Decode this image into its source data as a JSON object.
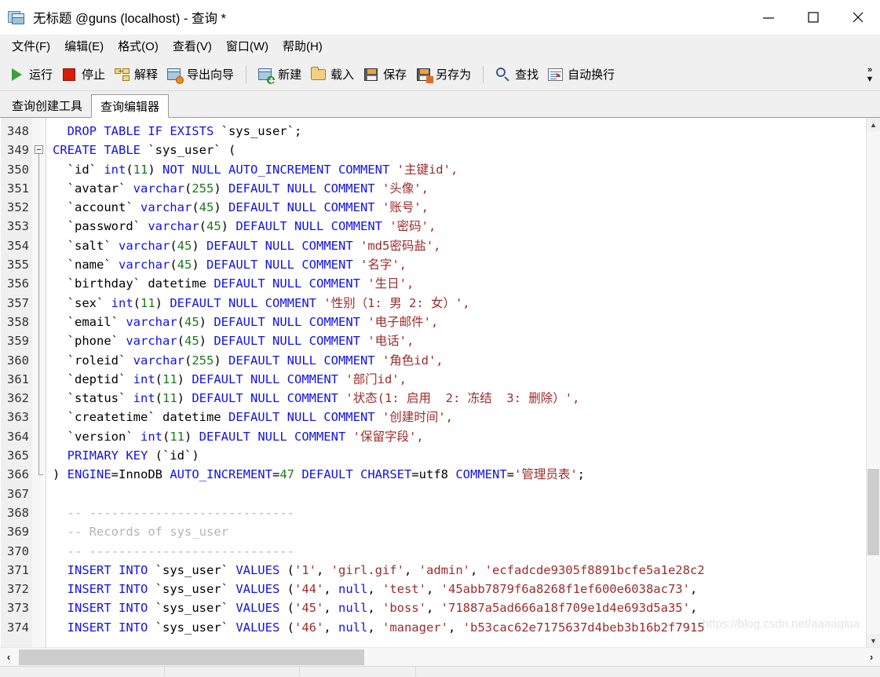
{
  "window": {
    "title": "无标题 @guns (localhost) - 查询 *",
    "icon": "query-table-icon",
    "controls": {
      "minimize": "minimize-icon",
      "maximize": "maximize-icon",
      "close": "close-icon"
    }
  },
  "menubar": {
    "items": [
      {
        "label": "文件(F)",
        "mnemonic": "F"
      },
      {
        "label": "编辑(E)",
        "mnemonic": "E"
      },
      {
        "label": "格式(O)",
        "mnemonic": "O"
      },
      {
        "label": "查看(V)",
        "mnemonic": "V"
      },
      {
        "label": "窗口(W)",
        "mnemonic": "W"
      },
      {
        "label": "帮助(H)",
        "mnemonic": "H"
      }
    ]
  },
  "toolbar": {
    "buttons": [
      {
        "label": "运行",
        "icon": "play-icon"
      },
      {
        "label": "停止",
        "icon": "stop-icon"
      },
      {
        "label": "解释",
        "icon": "explain-icon"
      },
      {
        "label": "导出向导",
        "icon": "export-wizard-icon"
      },
      {
        "label": "新建",
        "icon": "new-query-icon"
      },
      {
        "label": "载入",
        "icon": "open-folder-icon"
      },
      {
        "label": "保存",
        "icon": "save-icon"
      },
      {
        "label": "另存为",
        "icon": "save-as-icon"
      },
      {
        "label": "查找",
        "icon": "search-icon"
      },
      {
        "label": "自动换行",
        "icon": "word-wrap-icon"
      }
    ],
    "overflow": "»"
  },
  "tabs": [
    {
      "label": "查询创建工具",
      "active": false
    },
    {
      "label": "查询编辑器",
      "active": true
    }
  ],
  "editor": {
    "first_line_number": 348,
    "colors": {
      "keyword": "#1111ee",
      "number": "#1a7a1a",
      "string": "#9e2b2b",
      "comment": "#b4b4b4",
      "plain": "#000000",
      "gutter_bg": "#f0f0f0",
      "background": "#ffffff"
    },
    "lines": [
      {
        "n": 348,
        "tokens": [
          {
            "t": "  ",
            "c": "pln"
          },
          {
            "t": "DROP TABLE IF EXISTS",
            "c": "kw"
          },
          {
            "t": " `sys_user`;",
            "c": "pln"
          }
        ]
      },
      {
        "n": 349,
        "fold": "start",
        "tokens": [
          {
            "t": "CREATE TABLE",
            "c": "kw"
          },
          {
            "t": " `sys_user` (",
            "c": "pln"
          }
        ]
      },
      {
        "n": 350,
        "fold": "mid",
        "tokens": [
          {
            "t": "  `id` ",
            "c": "pln"
          },
          {
            "t": "int",
            "c": "kw"
          },
          {
            "t": "(",
            "c": "pln"
          },
          {
            "t": "11",
            "c": "num"
          },
          {
            "t": ") ",
            "c": "pln"
          },
          {
            "t": "NOT NULL AUTO_INCREMENT COMMENT",
            "c": "kw"
          },
          {
            "t": " '主键id',",
            "c": "str"
          }
        ]
      },
      {
        "n": 351,
        "fold": "mid",
        "tokens": [
          {
            "t": "  `avatar` ",
            "c": "pln"
          },
          {
            "t": "varchar",
            "c": "kw"
          },
          {
            "t": "(",
            "c": "pln"
          },
          {
            "t": "255",
            "c": "num"
          },
          {
            "t": ") ",
            "c": "pln"
          },
          {
            "t": "DEFAULT NULL COMMENT",
            "c": "kw"
          },
          {
            "t": " '头像',",
            "c": "str"
          }
        ]
      },
      {
        "n": 352,
        "fold": "mid",
        "tokens": [
          {
            "t": "  `account` ",
            "c": "pln"
          },
          {
            "t": "varchar",
            "c": "kw"
          },
          {
            "t": "(",
            "c": "pln"
          },
          {
            "t": "45",
            "c": "num"
          },
          {
            "t": ") ",
            "c": "pln"
          },
          {
            "t": "DEFAULT NULL COMMENT",
            "c": "kw"
          },
          {
            "t": " '账号',",
            "c": "str"
          }
        ]
      },
      {
        "n": 353,
        "fold": "mid",
        "tokens": [
          {
            "t": "  `password` ",
            "c": "pln"
          },
          {
            "t": "varchar",
            "c": "kw"
          },
          {
            "t": "(",
            "c": "pln"
          },
          {
            "t": "45",
            "c": "num"
          },
          {
            "t": ") ",
            "c": "pln"
          },
          {
            "t": "DEFAULT NULL COMMENT",
            "c": "kw"
          },
          {
            "t": " '密码',",
            "c": "str"
          }
        ]
      },
      {
        "n": 354,
        "fold": "mid",
        "tokens": [
          {
            "t": "  `salt` ",
            "c": "pln"
          },
          {
            "t": "varchar",
            "c": "kw"
          },
          {
            "t": "(",
            "c": "pln"
          },
          {
            "t": "45",
            "c": "num"
          },
          {
            "t": ") ",
            "c": "pln"
          },
          {
            "t": "DEFAULT NULL COMMENT",
            "c": "kw"
          },
          {
            "t": " 'md5密码盐',",
            "c": "str"
          }
        ]
      },
      {
        "n": 355,
        "fold": "mid",
        "tokens": [
          {
            "t": "  `name` ",
            "c": "pln"
          },
          {
            "t": "varchar",
            "c": "kw"
          },
          {
            "t": "(",
            "c": "pln"
          },
          {
            "t": "45",
            "c": "num"
          },
          {
            "t": ") ",
            "c": "pln"
          },
          {
            "t": "DEFAULT NULL COMMENT",
            "c": "kw"
          },
          {
            "t": " '名字',",
            "c": "str"
          }
        ]
      },
      {
        "n": 356,
        "fold": "mid",
        "tokens": [
          {
            "t": "  `birthday` ",
            "c": "pln"
          },
          {
            "t": "datetime",
            "c": "pln"
          },
          {
            "t": " ",
            "c": "pln"
          },
          {
            "t": "DEFAULT NULL COMMENT",
            "c": "kw"
          },
          {
            "t": " '生日',",
            "c": "str"
          }
        ]
      },
      {
        "n": 357,
        "fold": "mid",
        "tokens": [
          {
            "t": "  `sex` ",
            "c": "pln"
          },
          {
            "t": "int",
            "c": "kw"
          },
          {
            "t": "(",
            "c": "pln"
          },
          {
            "t": "11",
            "c": "num"
          },
          {
            "t": ") ",
            "c": "pln"
          },
          {
            "t": "DEFAULT NULL COMMENT",
            "c": "kw"
          },
          {
            "t": " '性别（1: 男 2: 女）',",
            "c": "str"
          }
        ]
      },
      {
        "n": 358,
        "fold": "mid",
        "tokens": [
          {
            "t": "  `email` ",
            "c": "pln"
          },
          {
            "t": "varchar",
            "c": "kw"
          },
          {
            "t": "(",
            "c": "pln"
          },
          {
            "t": "45",
            "c": "num"
          },
          {
            "t": ") ",
            "c": "pln"
          },
          {
            "t": "DEFAULT NULL COMMENT",
            "c": "kw"
          },
          {
            "t": " '电子邮件',",
            "c": "str"
          }
        ]
      },
      {
        "n": 359,
        "fold": "mid",
        "tokens": [
          {
            "t": "  `phone` ",
            "c": "pln"
          },
          {
            "t": "varchar",
            "c": "kw"
          },
          {
            "t": "(",
            "c": "pln"
          },
          {
            "t": "45",
            "c": "num"
          },
          {
            "t": ") ",
            "c": "pln"
          },
          {
            "t": "DEFAULT NULL COMMENT",
            "c": "kw"
          },
          {
            "t": " '电话',",
            "c": "str"
          }
        ]
      },
      {
        "n": 360,
        "fold": "mid",
        "tokens": [
          {
            "t": "  `roleid` ",
            "c": "pln"
          },
          {
            "t": "varchar",
            "c": "kw"
          },
          {
            "t": "(",
            "c": "pln"
          },
          {
            "t": "255",
            "c": "num"
          },
          {
            "t": ") ",
            "c": "pln"
          },
          {
            "t": "DEFAULT NULL COMMENT",
            "c": "kw"
          },
          {
            "t": " '角色id',",
            "c": "str"
          }
        ]
      },
      {
        "n": 361,
        "fold": "mid",
        "tokens": [
          {
            "t": "  `deptid` ",
            "c": "pln"
          },
          {
            "t": "int",
            "c": "kw"
          },
          {
            "t": "(",
            "c": "pln"
          },
          {
            "t": "11",
            "c": "num"
          },
          {
            "t": ") ",
            "c": "pln"
          },
          {
            "t": "DEFAULT NULL COMMENT",
            "c": "kw"
          },
          {
            "t": " '部门id',",
            "c": "str"
          }
        ]
      },
      {
        "n": 362,
        "fold": "mid",
        "tokens": [
          {
            "t": "  `status` ",
            "c": "pln"
          },
          {
            "t": "int",
            "c": "kw"
          },
          {
            "t": "(",
            "c": "pln"
          },
          {
            "t": "11",
            "c": "num"
          },
          {
            "t": ") ",
            "c": "pln"
          },
          {
            "t": "DEFAULT NULL COMMENT",
            "c": "kw"
          },
          {
            "t": " '状态(1: 启用  2: 冻结  3: 删除）',",
            "c": "str"
          }
        ]
      },
      {
        "n": 363,
        "fold": "mid",
        "tokens": [
          {
            "t": "  `createtime` ",
            "c": "pln"
          },
          {
            "t": "datetime",
            "c": "pln"
          },
          {
            "t": " ",
            "c": "pln"
          },
          {
            "t": "DEFAULT NULL COMMENT",
            "c": "kw"
          },
          {
            "t": " '创建时间',",
            "c": "str"
          }
        ]
      },
      {
        "n": 364,
        "fold": "mid",
        "tokens": [
          {
            "t": "  `version` ",
            "c": "pln"
          },
          {
            "t": "int",
            "c": "kw"
          },
          {
            "t": "(",
            "c": "pln"
          },
          {
            "t": "11",
            "c": "num"
          },
          {
            "t": ") ",
            "c": "pln"
          },
          {
            "t": "DEFAULT NULL COMMENT",
            "c": "kw"
          },
          {
            "t": " '保留字段',",
            "c": "str"
          }
        ]
      },
      {
        "n": 365,
        "fold": "mid",
        "tokens": [
          {
            "t": "  ",
            "c": "pln"
          },
          {
            "t": "PRIMARY KEY",
            "c": "kw"
          },
          {
            "t": " (`id`)",
            "c": "pln"
          }
        ]
      },
      {
        "n": 366,
        "fold": "end",
        "tokens": [
          {
            "t": ") ",
            "c": "pln"
          },
          {
            "t": "ENGINE",
            "c": "kw"
          },
          {
            "t": "=InnoDB ",
            "c": "pln"
          },
          {
            "t": "AUTO_INCREMENT",
            "c": "kw"
          },
          {
            "t": "=",
            "c": "pln"
          },
          {
            "t": "47",
            "c": "num"
          },
          {
            "t": " ",
            "c": "pln"
          },
          {
            "t": "DEFAULT CHARSET",
            "c": "kw"
          },
          {
            "t": "=utf8 ",
            "c": "pln"
          },
          {
            "t": "COMMENT",
            "c": "kw"
          },
          {
            "t": "=",
            "c": "pln"
          },
          {
            "t": "'管理员表'",
            "c": "str"
          },
          {
            "t": ";",
            "c": "pln"
          }
        ]
      },
      {
        "n": 367,
        "tokens": []
      },
      {
        "n": 368,
        "tokens": [
          {
            "t": "  -- ----------------------------",
            "c": "cmt"
          }
        ]
      },
      {
        "n": 369,
        "tokens": [
          {
            "t": "  -- Records of sys_user",
            "c": "cmt"
          }
        ]
      },
      {
        "n": 370,
        "tokens": [
          {
            "t": "  -- ----------------------------",
            "c": "cmt"
          }
        ]
      },
      {
        "n": 371,
        "tokens": [
          {
            "t": "  ",
            "c": "pln"
          },
          {
            "t": "INSERT INTO",
            "c": "kw"
          },
          {
            "t": " `sys_user` ",
            "c": "pln"
          },
          {
            "t": "VALUES",
            "c": "kw"
          },
          {
            "t": " (",
            "c": "pln"
          },
          {
            "t": "'1'",
            "c": "str"
          },
          {
            "t": ", ",
            "c": "pln"
          },
          {
            "t": "'girl.gif'",
            "c": "str"
          },
          {
            "t": ", ",
            "c": "pln"
          },
          {
            "t": "'admin'",
            "c": "str"
          },
          {
            "t": ", ",
            "c": "pln"
          },
          {
            "t": "'ecfadcde9305f8891bcfe5a1e28c2",
            "c": "str"
          }
        ]
      },
      {
        "n": 372,
        "tokens": [
          {
            "t": "  ",
            "c": "pln"
          },
          {
            "t": "INSERT INTO",
            "c": "kw"
          },
          {
            "t": " `sys_user` ",
            "c": "pln"
          },
          {
            "t": "VALUES",
            "c": "kw"
          },
          {
            "t": " (",
            "c": "pln"
          },
          {
            "t": "'44'",
            "c": "str"
          },
          {
            "t": ", ",
            "c": "pln"
          },
          {
            "t": "null",
            "c": "kw"
          },
          {
            "t": ", ",
            "c": "pln"
          },
          {
            "t": "'test'",
            "c": "str"
          },
          {
            "t": ", ",
            "c": "pln"
          },
          {
            "t": "'45abb7879f6a8268f1ef600e6038ac73'",
            "c": "str"
          },
          {
            "t": ",",
            "c": "pln"
          }
        ]
      },
      {
        "n": 373,
        "tokens": [
          {
            "t": "  ",
            "c": "pln"
          },
          {
            "t": "INSERT INTO",
            "c": "kw"
          },
          {
            "t": " `sys_user` ",
            "c": "pln"
          },
          {
            "t": "VALUES",
            "c": "kw"
          },
          {
            "t": " (",
            "c": "pln"
          },
          {
            "t": "'45'",
            "c": "str"
          },
          {
            "t": ", ",
            "c": "pln"
          },
          {
            "t": "null",
            "c": "kw"
          },
          {
            "t": ", ",
            "c": "pln"
          },
          {
            "t": "'boss'",
            "c": "str"
          },
          {
            "t": ", ",
            "c": "pln"
          },
          {
            "t": "'71887a5ad666a18f709e1d4e693d5a35'",
            "c": "str"
          },
          {
            "t": ",",
            "c": "pln"
          }
        ]
      },
      {
        "n": 374,
        "tokens": [
          {
            "t": "  ",
            "c": "pln"
          },
          {
            "t": "INSERT INTO",
            "c": "kw"
          },
          {
            "t": " `sys_user` ",
            "c": "pln"
          },
          {
            "t": "VALUES",
            "c": "kw"
          },
          {
            "t": " (",
            "c": "pln"
          },
          {
            "t": "'46'",
            "c": "str"
          },
          {
            "t": ", ",
            "c": "pln"
          },
          {
            "t": "null",
            "c": "kw"
          },
          {
            "t": ", ",
            "c": "pln"
          },
          {
            "t": "'manager'",
            "c": "str"
          },
          {
            "t": ", ",
            "c": "pln"
          },
          {
            "t": "'b53cac62e7175637d4beb3b16b2f7915",
            "c": "str"
          }
        ]
      }
    ]
  },
  "scrollbars": {
    "vertical": {
      "up": "▲",
      "down": "▼"
    },
    "horizontal": {
      "left": "‹",
      "right": "›"
    }
  },
  "watermark": "https://blog.csdn.net/aaaaqiua",
  "statusbar": {
    "cells": [
      "",
      "",
      "",
      ""
    ]
  }
}
